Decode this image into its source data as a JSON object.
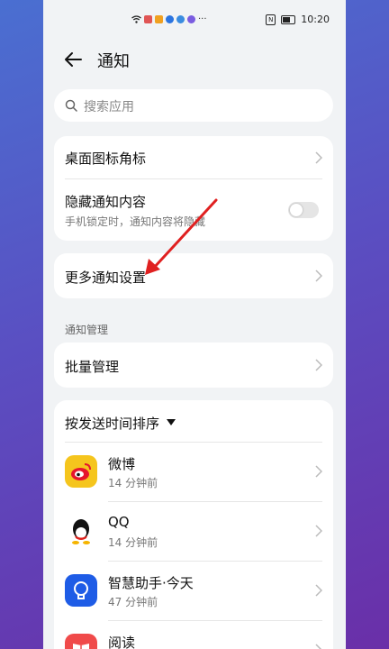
{
  "status_bar": {
    "time": "10:20",
    "more_indicator": "···",
    "notification_dot_colors": [
      "#e05555",
      "#f0a020",
      "#2b74e0",
      "#3a8ce0",
      "#7a5ce0"
    ]
  },
  "header": {
    "title": "通知",
    "back_icon": "arrow-left-icon"
  },
  "search": {
    "placeholder": "搜索应用",
    "icon": "search-icon"
  },
  "settings": {
    "badge_label": "桌面图标角标",
    "hide_content_label": "隐藏通知内容",
    "hide_content_sub": "手机锁定时，通知内容将隐藏",
    "hide_content_enabled": false,
    "more_settings_label": "更多通知设置"
  },
  "management": {
    "section_title": "通知管理",
    "batch_label": "批量管理"
  },
  "sort": {
    "label": "按发送时间排序"
  },
  "apps": [
    {
      "name": "微博",
      "time": "14 分钟前",
      "icon": "weibo-icon"
    },
    {
      "name": "QQ",
      "time": "14 分钟前",
      "icon": "qq-icon"
    },
    {
      "name": "智慧助手·今天",
      "time": "47 分钟前",
      "icon": "assistant-bulb-icon"
    },
    {
      "name": "阅读",
      "time": "",
      "icon": "reading-book-icon"
    }
  ],
  "colors": {
    "annotation_arrow": "#e02020",
    "background": "#f1f3f5"
  }
}
